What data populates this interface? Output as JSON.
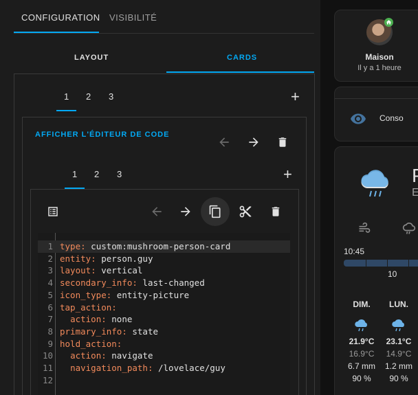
{
  "top_tabs": [
    {
      "label": "CONFIGURATION",
      "active": true
    },
    {
      "label": "VISIBILITÉ",
      "active": false
    }
  ],
  "sub_tabs": [
    {
      "label": "LAYOUT",
      "active": false
    },
    {
      "label": "CARDS",
      "active": true
    }
  ],
  "outer_card_tabs": [
    "1",
    "2",
    "3"
  ],
  "inner_card_tabs": [
    "1",
    "2",
    "3"
  ],
  "code_editor_link": "AFFICHER L'ÉDITEUR DE CODE",
  "code_lines": [
    {
      "n": "1",
      "key": "type",
      "val": " custom:mushroom-person-card",
      "indent": ""
    },
    {
      "n": "2",
      "key": "entity",
      "val": " person.guy",
      "indent": ""
    },
    {
      "n": "3",
      "key": "layout",
      "val": " vertical",
      "indent": ""
    },
    {
      "n": "4",
      "key": "secondary_info",
      "val": " last-changed",
      "indent": ""
    },
    {
      "n": "5",
      "key": "icon_type",
      "val": " entity-picture",
      "indent": ""
    },
    {
      "n": "6",
      "key": "tap_action",
      "val": "",
      "indent": ""
    },
    {
      "n": "7",
      "key": "action",
      "val": " none",
      "indent": "  "
    },
    {
      "n": "8",
      "key": "primary_info",
      "val": " state",
      "indent": ""
    },
    {
      "n": "9",
      "key": "hold_action",
      "val": "",
      "indent": ""
    },
    {
      "n": "10",
      "key": "action",
      "val": " navigate",
      "indent": "  "
    },
    {
      "n": "11",
      "key": "navigation_path",
      "val": " /lovelace/guy",
      "indent": "  "
    },
    {
      "n": "12",
      "key": "",
      "val": "",
      "indent": ""
    }
  ],
  "preview": {
    "person_name": "Maison",
    "person_time": "Il y a 1 heure",
    "conso_label": "Conso",
    "weather_big_letter": "P",
    "weather_small_letter": "E",
    "time": "10:45",
    "scale_value": "10",
    "forecast": [
      {
        "day": "DIM.",
        "high": "21.9°C",
        "low": "16.9°C",
        "rain": "6.7 mm",
        "humidity": "90 %"
      },
      {
        "day": "LUN.",
        "high": "23.1°C",
        "low": "14.9°C",
        "rain": "1.2 mm",
        "humidity": "90 %"
      }
    ]
  },
  "colors": {
    "accent": "#03a9f4",
    "code_key": "#f28a5b",
    "badge": "#4caf50"
  }
}
